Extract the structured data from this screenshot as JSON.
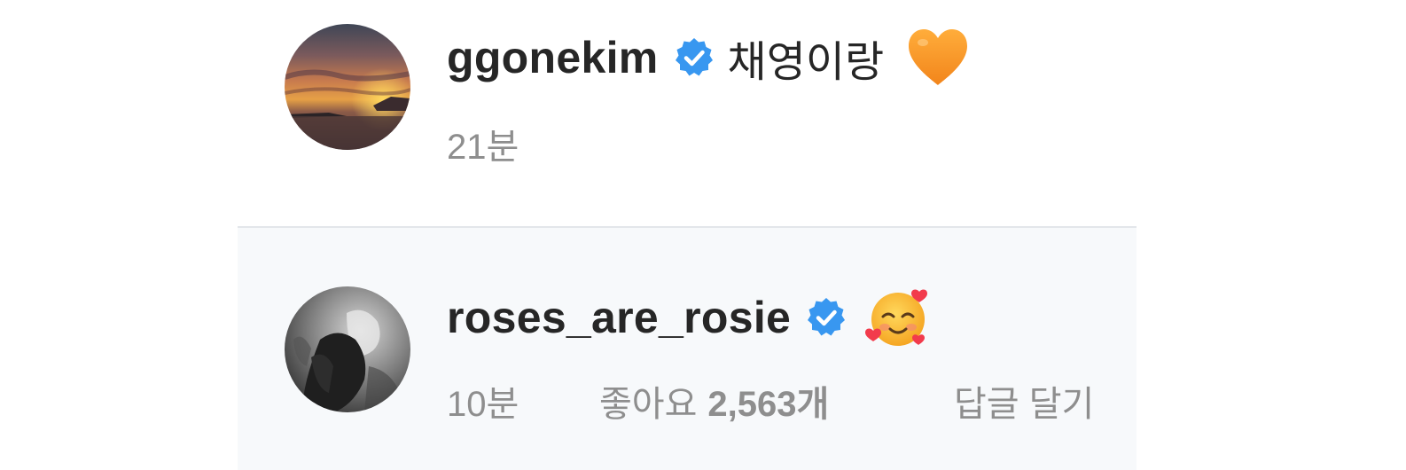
{
  "colors": {
    "text_primary": "#262626",
    "text_secondary": "#8e8e8e",
    "verified_blue": "#3897f0",
    "highlight_background": "#f7f9fb",
    "divider": "#e3e6ea"
  },
  "comments": [
    {
      "username": "ggonekim",
      "verified": true,
      "text": "채영이랑",
      "emoji": "orange-heart",
      "time": "21분"
    },
    {
      "username": "roses_are_rosie",
      "verified": true,
      "text": "",
      "emoji": "smiling-face-with-hearts",
      "time": "10분",
      "likes_label": "좋아요",
      "likes_count": "2,563개",
      "reply_label": "답글 달기"
    }
  ]
}
